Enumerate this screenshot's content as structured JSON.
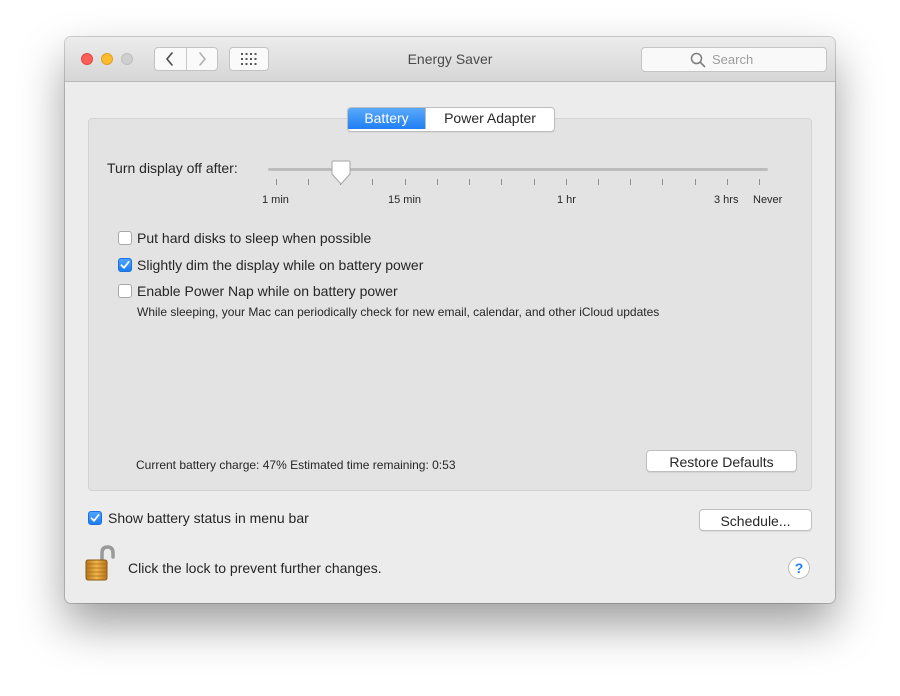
{
  "window": {
    "title": "Energy Saver",
    "search_placeholder": "Search"
  },
  "tabs": [
    {
      "label": "Battery",
      "selected": true
    },
    {
      "label": "Power Adapter",
      "selected": false
    }
  ],
  "slider": {
    "label": "Turn display off after:",
    "tick_labels": [
      "1 min",
      "15 min",
      "1 hr",
      "3 hrs",
      "Never"
    ],
    "current_value": "about 5 min"
  },
  "options": [
    {
      "label": "Put hard disks to sleep when possible",
      "checked": false
    },
    {
      "label": "Slightly dim the display while on battery power",
      "checked": true
    },
    {
      "label": "Enable Power Nap while on battery power",
      "checked": false
    }
  ],
  "power_nap_note": "While sleeping, your Mac can periodically check for new email, calendar, and other iCloud updates",
  "status_text": "Current battery charge: 47%  Estimated time remaining: 0:53",
  "buttons": {
    "restore_defaults": "Restore Defaults",
    "schedule": "Schedule..."
  },
  "menu_bar_option": {
    "label": "Show battery status in menu bar",
    "checked": true
  },
  "lock_text": "Click the lock to prevent further changes.",
  "help_label": "?",
  "colors": {
    "accent": "#1f7ff3",
    "panel": "#e3e3e3",
    "window": "#ececec"
  }
}
